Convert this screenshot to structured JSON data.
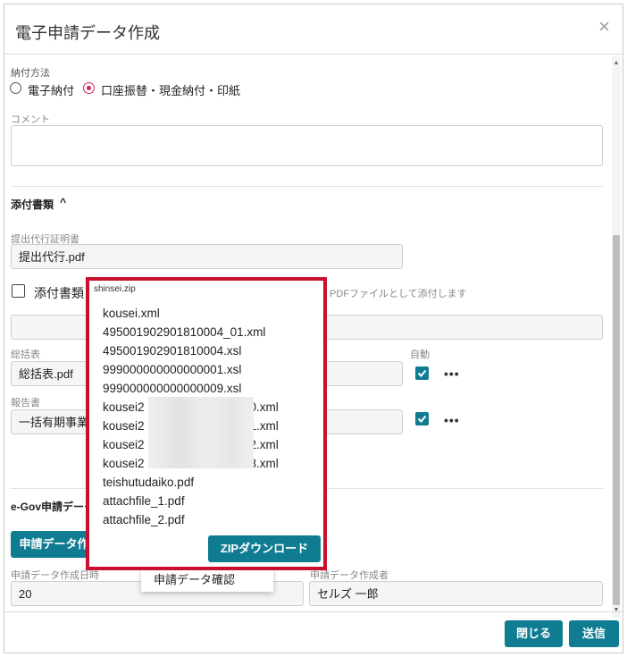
{
  "dialog": {
    "title": "電子申請データ作成",
    "close_icon": "×"
  },
  "payment": {
    "label": "納付方法",
    "options": [
      {
        "label": "電子納付",
        "selected": false
      },
      {
        "label": "口座振替・現金納付・印紙",
        "selected": true
      }
    ]
  },
  "comment": {
    "label": "コメント",
    "value": ""
  },
  "attachments": {
    "header": "添付書類",
    "chevron": "^",
    "proxy_cert": {
      "label": "提出代行証明書",
      "value": "提出代行.pdf"
    },
    "attach_checkbox": {
      "label": "添付書類",
      "hint": "PDFファイルとして添付します",
      "checked": false
    },
    "attach_value": "",
    "summary": {
      "label": "総括表",
      "value": "総括表.pdf",
      "auto_label": "自動",
      "checked": true
    },
    "report": {
      "label": "報告書",
      "value": "一括有期事業報告",
      "checked": true
    },
    "more_icon": "•••"
  },
  "egov": {
    "header": "e-Gov申請データ",
    "create_button": "申請データ作成",
    "menu_item": "申請データ確認",
    "created_date": {
      "label": "申請データ作成日時",
      "value": "20"
    },
    "creator": {
      "label": "申請データ作成者",
      "value": "セルズ 一郎"
    }
  },
  "zip_popup": {
    "filename": "shinsei.zip",
    "files": [
      "kousei.xml",
      "495001902901810004_01.xml",
      "495001902901810004.xsl",
      "999000000000000001.xsl",
      "999000000000000009.xsl",
      "kousei2",
      "kousei2",
      "kousei2",
      "kousei2",
      "teishutudaiko.pdf",
      "attachfile_1.pdf",
      "attachfile_2.pdf"
    ],
    "file_suffixes": [
      "0.xml",
      "1.xml",
      "2.xml",
      "3.xml"
    ],
    "download_button": "ZIPダウンロード"
  },
  "footer": {
    "close_button": "閉じる",
    "send_button": "送信"
  },
  "colors": {
    "accent": "#0f7c91",
    "highlight": "#c8102e",
    "radio": "#d0245d"
  }
}
